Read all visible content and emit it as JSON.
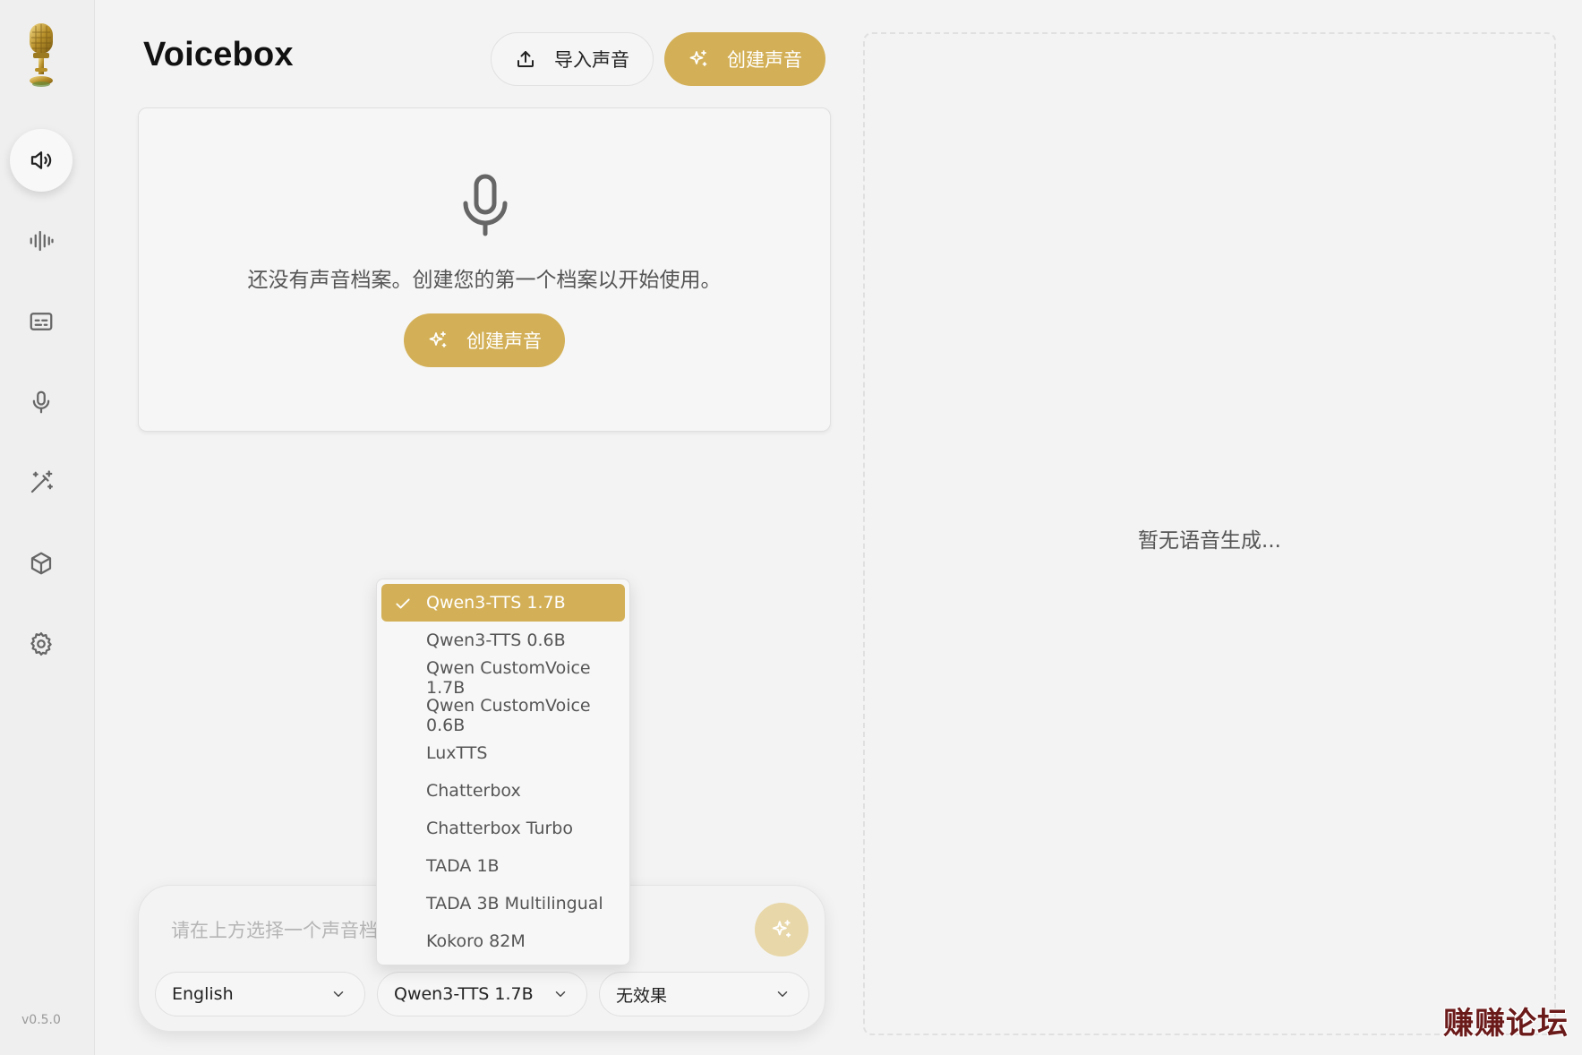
{
  "app": {
    "title": "Voicebox",
    "version": "v0.5.0"
  },
  "sidebar": {
    "items": [
      {
        "icon": "speaker-icon",
        "active": true
      },
      {
        "icon": "waveform-icon",
        "active": false
      },
      {
        "icon": "subtitles-icon",
        "active": false
      },
      {
        "icon": "microphone-icon",
        "active": false
      },
      {
        "icon": "magic-wand-icon",
        "active": false
      },
      {
        "icon": "cube-icon",
        "active": false
      },
      {
        "icon": "gear-icon",
        "active": false
      }
    ]
  },
  "header": {
    "import_label": "导入声音",
    "create_label": "创建声音"
  },
  "empty_state": {
    "message": "还没有声音档案。创建您的第一个档案以开始使用。",
    "create_label": "创建声音"
  },
  "history": {
    "empty_message": "暂无语音生成..."
  },
  "composer": {
    "placeholder": "请在上方选择一个声音档案",
    "language": "English",
    "model": "Qwen3-TTS 1.7B",
    "effect": "无效果"
  },
  "model_dropdown": {
    "selected_index": 0,
    "options": [
      "Qwen3-TTS 1.7B",
      "Qwen3-TTS 0.6B",
      "Qwen CustomVoice 1.7B",
      "Qwen CustomVoice 0.6B",
      "LuxTTS",
      "Chatterbox",
      "Chatterbox Turbo",
      "TADA 1B",
      "TADA 3B Multilingual",
      "Kokoro 82M"
    ]
  },
  "watermark": "赚赚论坛",
  "colors": {
    "accent": "#d3b057",
    "accent_light": "#e8d7a8",
    "background": "#f3f3f3"
  }
}
